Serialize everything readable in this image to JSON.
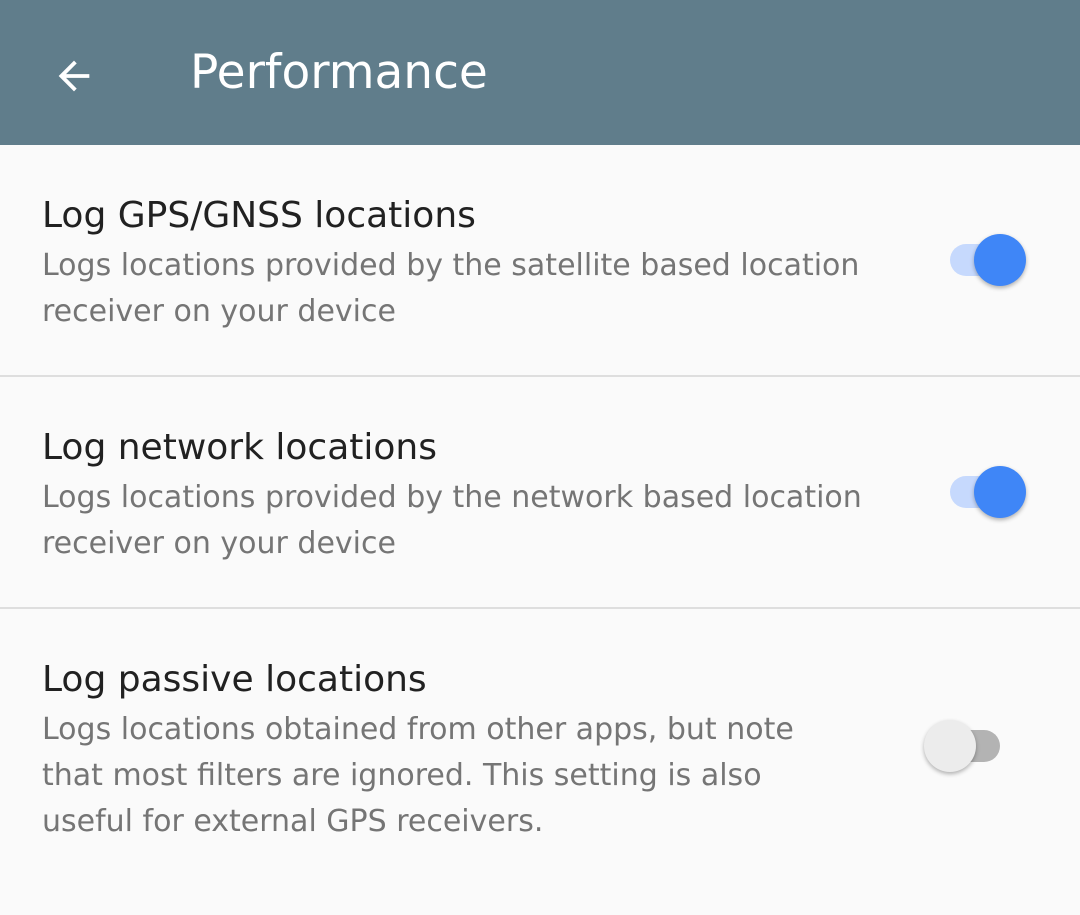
{
  "app_bar": {
    "back_icon": "arrow-back-icon",
    "title": "Performance",
    "background_color": "#607d8b"
  },
  "preferences": [
    {
      "title": "Log GPS/GNSS locations",
      "summary": "Logs locations provided by the satellite based location receiver on your device",
      "enabled": true
    },
    {
      "title": "Log network locations",
      "summary": "Logs locations provided by the network based location receiver on your device",
      "enabled": true
    },
    {
      "title": "Log passive locations",
      "summary": "Logs locations obtained from other apps, but note that most filters are ignored. This setting is also useful for external GPS receivers.",
      "enabled": false
    }
  ],
  "colors": {
    "switch_on_thumb": "#3f86f7",
    "switch_on_track": "#c6d9fd",
    "switch_off_thumb": "#ececec",
    "switch_off_track": "#b3b3b3"
  }
}
